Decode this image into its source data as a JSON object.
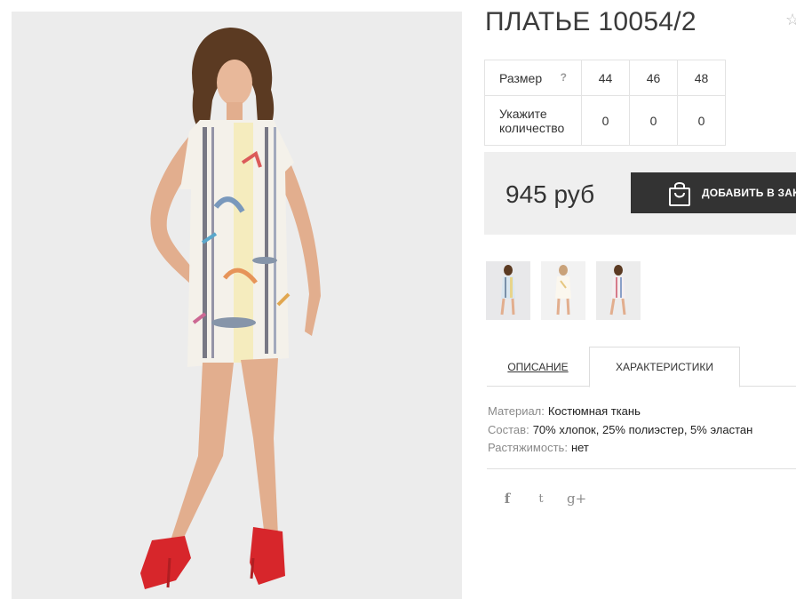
{
  "product": {
    "title": "ПЛАТЬЕ 10054/2",
    "image_alt": "model-photo"
  },
  "sizes": {
    "size_label": "Размер",
    "help_mark": "?",
    "qty_label_line1": "Укажите",
    "qty_label_line2": "количество",
    "values": [
      "44",
      "46",
      "48"
    ],
    "quantities": [
      "0",
      "0",
      "0"
    ]
  },
  "price": {
    "amount": "945 руб",
    "button_label": "ДОБАВИТЬ В ЗАКАЗ"
  },
  "tabs": {
    "description": "ОПИСАНИЕ",
    "characteristics": "ХАРАКТЕРИСТИКИ"
  },
  "characteristics": [
    {
      "key": "Материал:",
      "value": "Костюмная ткань"
    },
    {
      "key": "Состав:",
      "value": "70% хлопок, 25% полиэстер, 5% эластан"
    },
    {
      "key": "Растяжимость:",
      "value": "нет"
    }
  ],
  "social": {
    "facebook": "f",
    "twitter": "t",
    "googleplus": "g+"
  },
  "colors": {
    "button_bg": "#333333",
    "price_bg": "#efefef",
    "photo_bg": "#ececec",
    "shoe_red": "#d7262b"
  }
}
